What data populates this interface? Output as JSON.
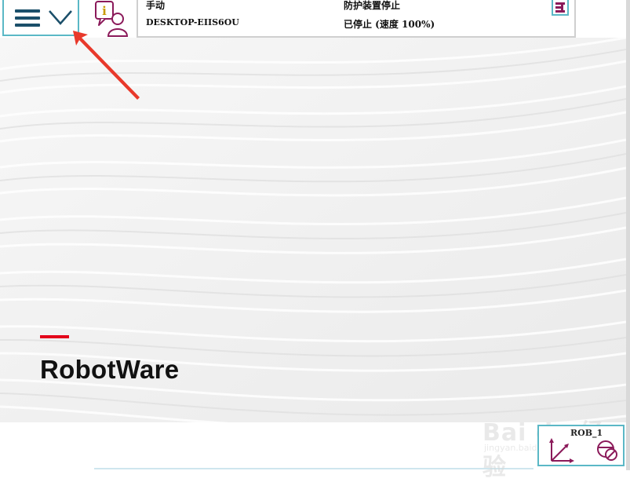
{
  "status": {
    "mode": "手动",
    "controller": "DESKTOP-EIIS6OU",
    "guard_state": "防护装置停止",
    "run_state": "已停止 (速度 100%)"
  },
  "brand": {
    "name": "RobotWare",
    "accent_color": "#e3001a"
  },
  "quickset": {
    "label": "ROB_1"
  },
  "watermark": {
    "text": "Bai du 经验",
    "sub": "jingyan.baidu.com"
  },
  "icons": {
    "menu": "hamburger-icon",
    "menu_expand": "chevron-down-icon",
    "event_log": "event-log-icon",
    "status": "status-icon",
    "jog": "jog-axes-icon",
    "stopped": "stopped-icon"
  },
  "colors": {
    "frame_border": "#5bb8c6",
    "menu_icon": "#1b4f6a",
    "event_icon": "#8b1a5a",
    "annotation_arrow": "#e8392b"
  }
}
